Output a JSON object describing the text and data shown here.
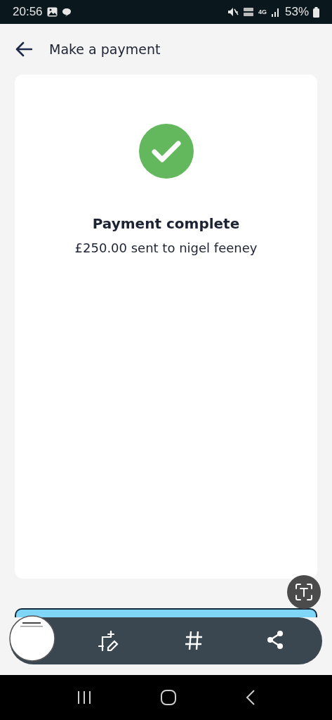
{
  "status_bar": {
    "time": "20:56",
    "battery": "53%",
    "network": "4G"
  },
  "app_bar": {
    "title": "Make a payment"
  },
  "result": {
    "title": "Payment complete",
    "message": "£250.00 sent to nigel feeney"
  }
}
